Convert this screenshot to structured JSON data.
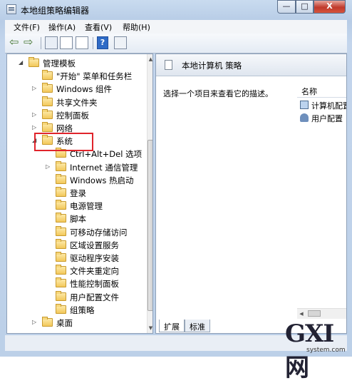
{
  "window": {
    "title": "本地组策略编辑器"
  },
  "caption_buttons": {
    "minimize": "—",
    "maximize": "□",
    "close": "X"
  },
  "menu": {
    "file": "文件(F)",
    "action": "操作(A)",
    "view": "查看(V)",
    "help": "帮助(H)"
  },
  "toolbar": {
    "back_glyph": "⇦",
    "forward_glyph": "⇨",
    "help_glyph": "?"
  },
  "tree": {
    "items": [
      {
        "label": "管理模板",
        "arrow": "◢"
      },
      {
        "label": "\"开始\" 菜单和任务栏",
        "arrow": ""
      },
      {
        "label": "Windows 组件",
        "arrow": "▷"
      },
      {
        "label": "共享文件夹",
        "arrow": ""
      },
      {
        "label": "控制面板",
        "arrow": "▷"
      },
      {
        "label": "网络",
        "arrow": "▷"
      },
      {
        "label": "系统",
        "arrow": "◢"
      },
      {
        "label": "Ctrl+Alt+Del 选项",
        "arrow": ""
      },
      {
        "label": "Internet 通信管理",
        "arrow": "▷"
      },
      {
        "label": "Windows 热启动",
        "arrow": ""
      },
      {
        "label": "登录",
        "arrow": ""
      },
      {
        "label": "电源管理",
        "arrow": ""
      },
      {
        "label": "脚本",
        "arrow": ""
      },
      {
        "label": "可移动存储访问",
        "arrow": ""
      },
      {
        "label": "区域设置服务",
        "arrow": ""
      },
      {
        "label": "驱动程序安装",
        "arrow": ""
      },
      {
        "label": "文件夹重定向",
        "arrow": ""
      },
      {
        "label": "性能控制面板",
        "arrow": ""
      },
      {
        "label": "用户配置文件",
        "arrow": ""
      },
      {
        "label": "组策略",
        "arrow": ""
      },
      {
        "label": "桌面",
        "arrow": "▷"
      }
    ],
    "scroll_up": "▲",
    "scroll_down": "▼"
  },
  "right_pane": {
    "header_title": "本地计算机 策略",
    "description": "选择一个项目来查看它的描述。",
    "column_name": "名称",
    "items": [
      {
        "label": "计算机配置",
        "icon": "computer-config-icon"
      },
      {
        "label": "用户配置",
        "icon": "user-config-icon"
      }
    ],
    "hscroll_left": "◀"
  },
  "tabs": {
    "extended": "扩展",
    "standard": "标准"
  },
  "watermark": {
    "logo": "GXI网",
    "url": "system.com"
  },
  "colors": {
    "highlight": "#e0242b",
    "titlebar": "#c9dbef"
  }
}
